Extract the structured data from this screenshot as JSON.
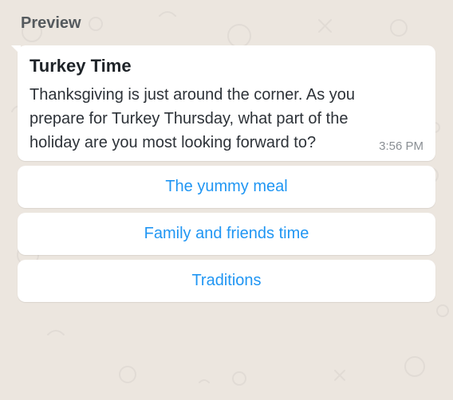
{
  "header": {
    "preview_label": "Preview"
  },
  "message": {
    "title": "Turkey Time",
    "body": "Thanksgiving is just around the corner. As you prepare for Turkey Thursday, what part of the holiday are you most looking forward to?",
    "timestamp": "3:56 PM"
  },
  "options": [
    {
      "label": "The yummy meal"
    },
    {
      "label": "Family and friends time"
    },
    {
      "label": "Traditions"
    }
  ],
  "colors": {
    "option_link": "#2096f3",
    "bubble_bg": "#ffffff",
    "page_bg": "#ece6df"
  }
}
